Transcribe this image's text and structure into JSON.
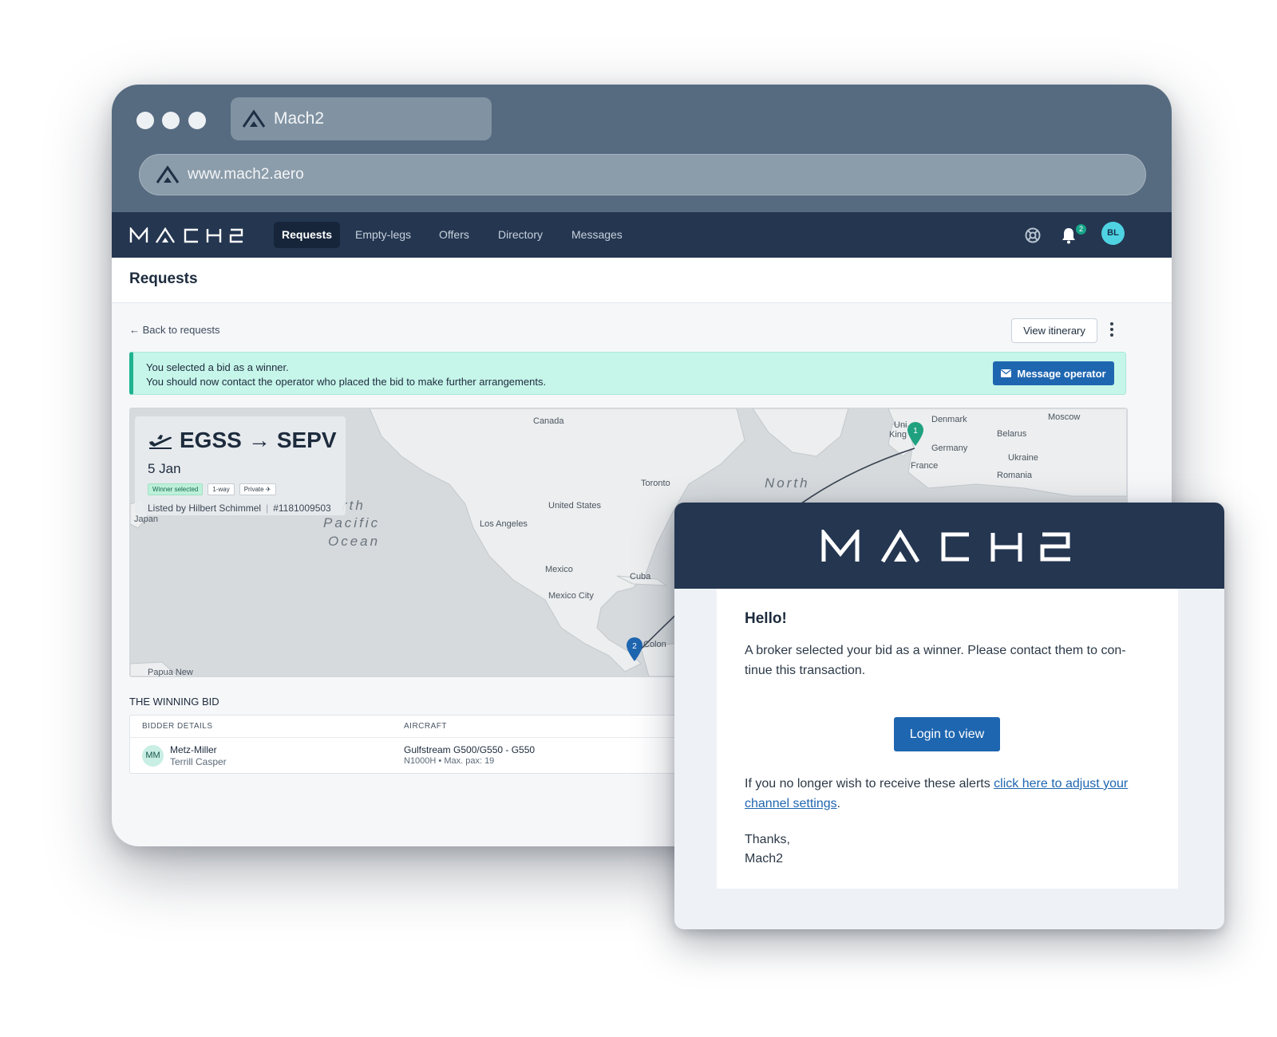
{
  "browser": {
    "tab_title": "Mach2",
    "url": "www.mach2.aero"
  },
  "app": {
    "logo_text": "MACH2",
    "nav": [
      "Requests",
      "Empty-legs",
      "Offers",
      "Directory",
      "Messages"
    ],
    "active_nav": "Requests",
    "notification_count": "2",
    "user_initials": "BL"
  },
  "page": {
    "title": "Requests",
    "back_link": "← Back to requests",
    "view_itinerary": "View itinerary"
  },
  "alert": {
    "line1": "You selected a bid as a winner.",
    "line2": "You should now contact the operator who placed the bid to make further arrangements.",
    "button": "Message operator"
  },
  "trip": {
    "from": "EGSS",
    "to": "SEPV",
    "date": "5 Jan",
    "tags": [
      "Winner selected",
      "1-way",
      "Private ✈"
    ],
    "listed_by": "Listed by Hilbert Schimmel",
    "ref": "#1181009503"
  },
  "map": {
    "labels": [
      "Canada",
      "United States",
      "Toronto",
      "Los Angeles",
      "Mexico",
      "Mexico City",
      "Cuba",
      "Japan",
      "Papua New",
      "Denmark",
      "Moscow",
      "Belarus",
      "Germany",
      "Ukraine",
      "France",
      "Romania",
      "Uni",
      "King",
      "Colon"
    ],
    "ocean_labels": [
      "rth",
      "Pacific",
      "Ocean",
      "North"
    ],
    "pins": [
      "1",
      "2"
    ]
  },
  "bid": {
    "section_title": "THE WINNING BID",
    "col_bidder": "BIDDER DETAILS",
    "col_aircraft": "AIRCRAFT",
    "bidder_initials": "MM",
    "bidder_company": "Metz-Miller",
    "bidder_name": "Terrill Casper",
    "aircraft": "Gulfstream G500/G550 - G550",
    "aircraft_detail": "N1000H • Max. pax: 19"
  },
  "email": {
    "greeting": "Hello!",
    "message": "A broker selected your bid as a winner. Please contact them to con- tinue this transaction.",
    "button": "Login to view",
    "unsub_prefix": "If you no longer wish to receive these alerts ",
    "unsub_link": "click here to adjust your channel settings",
    "unsub_suffix": ".",
    "sign_off": "Thanks,",
    "signature": "Mach2"
  },
  "colors": {
    "navy": "#243650",
    "chrome": "#566b80",
    "primary": "#1f66b0",
    "success_bg": "#c6f5e9",
    "success_accent": "#1fb38f"
  }
}
